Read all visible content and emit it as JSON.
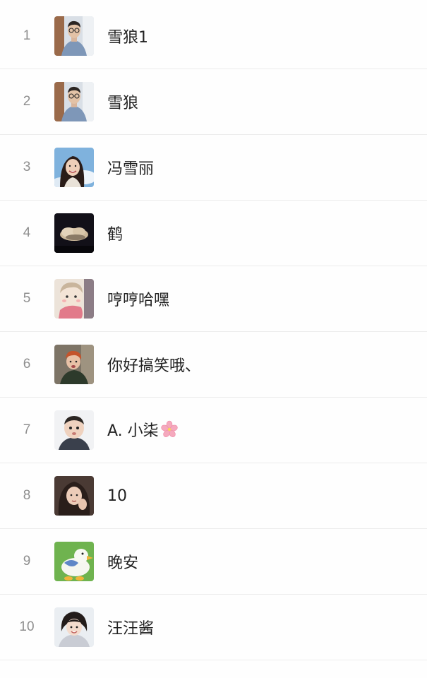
{
  "ranking": {
    "rows": [
      {
        "rank": "1",
        "name": "雪狼1",
        "avatar_icon": "man-with-glasses-avatar-icon"
      },
      {
        "rank": "2",
        "name": "雪狼",
        "avatar_icon": "man-with-glasses-avatar-icon"
      },
      {
        "rank": "3",
        "name": "冯雪丽",
        "avatar_icon": "woman-smiling-avatar-icon"
      },
      {
        "rank": "4",
        "name": "鹤",
        "avatar_icon": "night-cloud-avatar-icon"
      },
      {
        "rank": "5",
        "name": "哼哼哈嘿",
        "avatar_icon": "cartoon-child-avatar-icon"
      },
      {
        "rank": "6",
        "name": "你好搞笑哦、",
        "avatar_icon": "red-hair-boy-avatar-icon"
      },
      {
        "rank": "7",
        "name": "A. 小柒",
        "avatar_icon": "baby-avatar-icon",
        "suffix_icon": "cherry-blossom-icon"
      },
      {
        "rank": "8",
        "name": "10",
        "avatar_icon": "girl-dark-hair-avatar-icon"
      },
      {
        "rank": "9",
        "name": "晚安",
        "avatar_icon": "cartoon-duck-avatar-icon"
      },
      {
        "rank": "10",
        "name": "汪汪酱",
        "avatar_icon": "girl-short-hair-avatar-icon"
      }
    ]
  }
}
